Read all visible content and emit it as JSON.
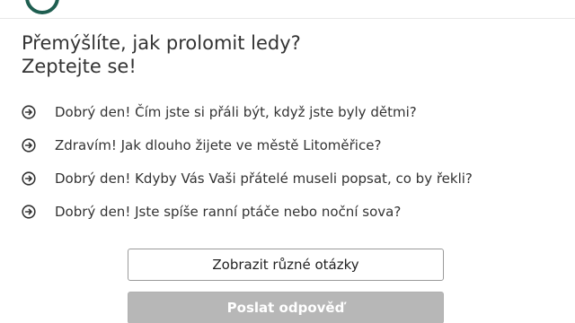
{
  "header": {
    "logo_icon": "brand-logo-icon",
    "logo_color": "#1e5e50"
  },
  "prompt": {
    "title_line1": "Přemýšlíte, jak prolomit ledy?",
    "title_line2": "Zeptejte se!"
  },
  "questions": [
    {
      "icon": "arrow-right-circle-icon",
      "text": "Dobrý den! Čím jste si přáli být, když jste byly dětmi?"
    },
    {
      "icon": "arrow-right-circle-icon",
      "text": "Zdravím! Jak dlouho žijete ve městě Litoměřice?"
    },
    {
      "icon": "arrow-right-circle-icon",
      "text": "Dobrý den! Kdyby Vás Vaši přátelé museli popsat, co by řekli?"
    },
    {
      "icon": "arrow-right-circle-icon",
      "text": "Dobrý den! Jste spíše ranní ptáče nebo noční sova?"
    }
  ],
  "actions": {
    "show_other_label": "Zobrazit různé otázky",
    "send_label": "Poslat odpověď",
    "send_disabled": true,
    "send_color": "#b7b7b7"
  }
}
